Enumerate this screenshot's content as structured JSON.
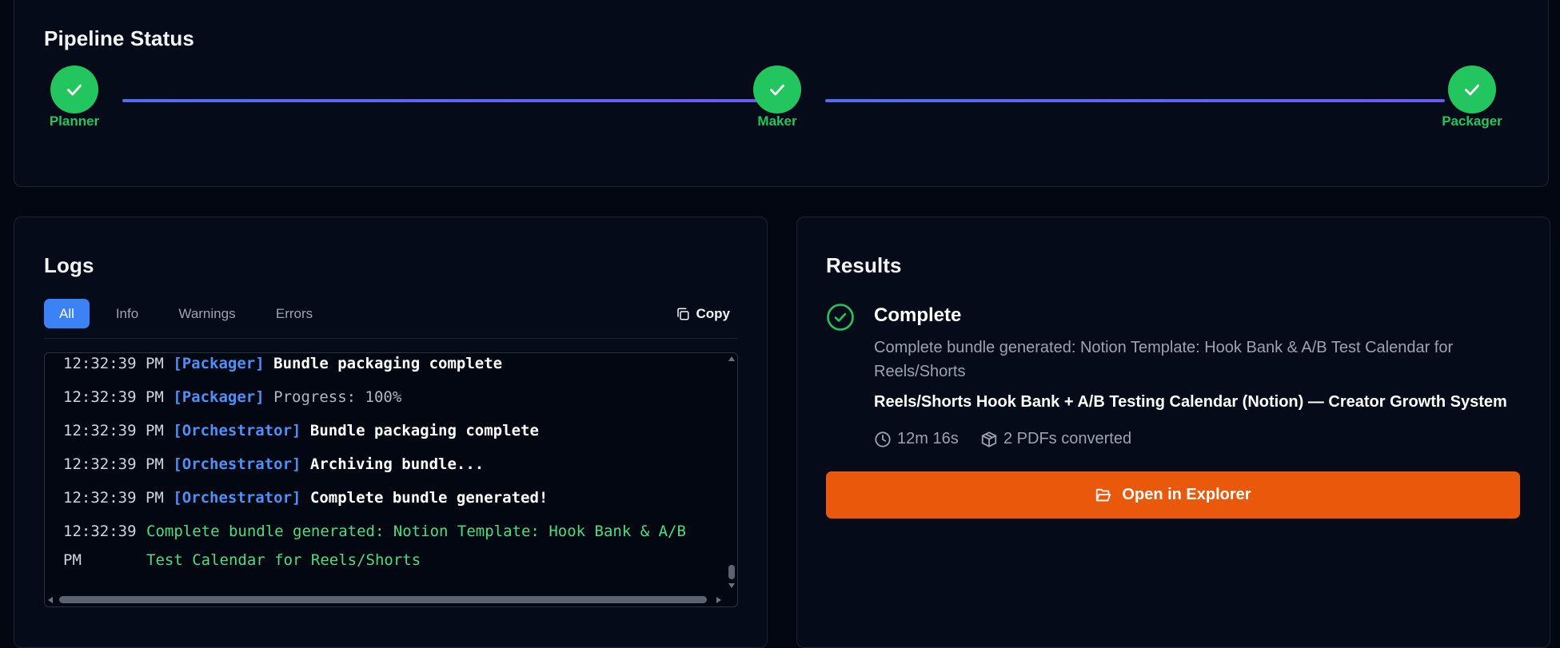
{
  "pipeline": {
    "title": "Pipeline Status",
    "steps": [
      {
        "label": "Planner",
        "status": "complete"
      },
      {
        "label": "Maker",
        "status": "complete"
      },
      {
        "label": "Packager",
        "status": "complete"
      }
    ]
  },
  "logs": {
    "title": "Logs",
    "tabs": [
      "All",
      "Info",
      "Warnings",
      "Errors"
    ],
    "active_tab": "All",
    "copy_label": "Copy",
    "lines": [
      {
        "time": "12:32:39 PM",
        "source": "[Packager]",
        "message": "Bundle packaging complete"
      },
      {
        "time": "12:32:39 PM",
        "source": "[Packager]",
        "message": "Progress: 100%"
      },
      {
        "time": "12:32:39 PM",
        "source": "[Orchestrator]",
        "message": "Bundle packaging complete"
      },
      {
        "time": "12:32:39 PM",
        "source": "[Orchestrator]",
        "message": "Archiving bundle..."
      },
      {
        "time": "12:32:39 PM",
        "source": "[Orchestrator]",
        "message": "Complete bundle generated!"
      },
      {
        "time": "12:32:39 PM",
        "source": "",
        "message": "Complete bundle generated: Notion Template: Hook Bank & A/B Test Calendar for Reels/Shorts"
      }
    ]
  },
  "results": {
    "title": "Results",
    "status": "Complete",
    "description": "Complete bundle generated: Notion Template: Hook Bank & A/B Test Calendar for Reels/Shorts",
    "product_title": "Reels/Shorts Hook Bank + A/B Testing Calendar (Notion) — Creator Growth System",
    "duration": "12m 16s",
    "pdfs": "2 PDFs converted",
    "open_button": "Open in Explorer"
  },
  "colors": {
    "success": "#22c55e",
    "accent": "#3b82f6",
    "source_tag": "#4f8ff7",
    "action": "#ea580c"
  },
  "icons": [
    "check-icon",
    "copy-icon",
    "clock-icon",
    "package-icon",
    "folder-open-icon",
    "check-circle-icon"
  ]
}
